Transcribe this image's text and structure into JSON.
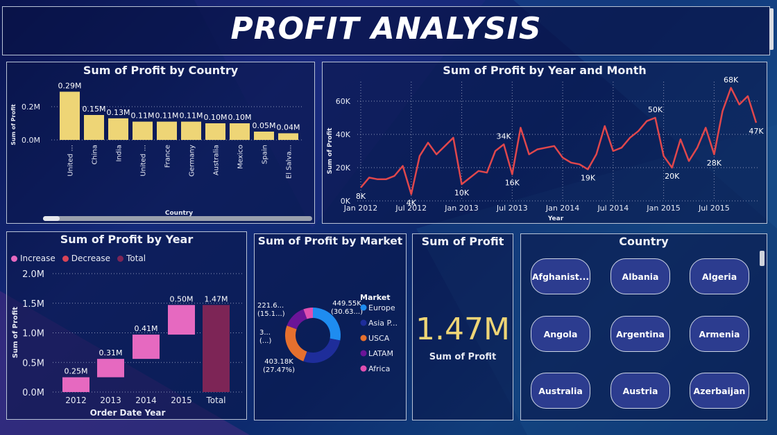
{
  "header": {
    "title": "PROFIT ANALYSIS"
  },
  "colors": {
    "bar_yellow": "#eed576",
    "line_red": "#e0474c",
    "increase": "#e669c0",
    "total": "#7d2556",
    "kpi": "#eed576"
  },
  "chart_data": [
    {
      "id": "country",
      "type": "bar",
      "title": "Sum of Profit by Country",
      "xlabel": "Country",
      "ylabel": "Sum of Profit",
      "categories": [
        "United ...",
        "China",
        "India",
        "United ...",
        "France",
        "Germany",
        "Australia",
        "Mexico",
        "Spain",
        "El Salva..."
      ],
      "values": [
        0.29,
        0.15,
        0.13,
        0.11,
        0.11,
        0.11,
        0.1,
        0.1,
        0.05,
        0.04
      ],
      "data_labels": [
        "0.29M",
        "0.15M",
        "0.13M",
        "0.11M",
        "0.11M",
        "0.11M",
        "0.10M",
        "0.10M",
        "0.05M",
        "0.04M"
      ],
      "yticks": [
        "0.0M",
        "0.2M"
      ],
      "ylim": [
        0,
        0.3
      ],
      "grid": true
    },
    {
      "id": "yearmonth",
      "type": "line",
      "title": "Sum of Profit by Year and Month",
      "xlabel": "Year",
      "ylabel": "Sum of Profit",
      "xticks": [
        "Jan 2012",
        "Jul 2012",
        "Jan 2013",
        "Jul 2013",
        "Jan 2014",
        "Jul 2014",
        "Jan 2015",
        "Jul 2015"
      ],
      "yticks": [
        "0K",
        "20K",
        "40K",
        "60K"
      ],
      "ylim": [
        0,
        60
      ],
      "values": [
        8,
        14,
        13,
        13,
        15,
        21,
        4,
        27,
        35,
        28,
        33,
        38,
        10,
        14,
        18,
        17,
        30,
        34,
        16,
        44,
        28,
        31,
        32,
        33,
        26,
        23,
        22,
        19,
        28,
        45,
        30,
        32,
        38,
        42,
        48,
        50,
        27,
        20,
        37,
        24,
        32,
        44,
        28,
        54,
        68,
        58,
        63,
        47
      ],
      "point_labels": [
        {
          "i": 0,
          "text": "8K"
        },
        {
          "i": 6,
          "text": "4K"
        },
        {
          "i": 12,
          "text": "10K"
        },
        {
          "i": 17,
          "text": "34K"
        },
        {
          "i": 18,
          "text": "16K"
        },
        {
          "i": 27,
          "text": "19K"
        },
        {
          "i": 35,
          "text": "50K"
        },
        {
          "i": 37,
          "text": "20K"
        },
        {
          "i": 42,
          "text": "28K"
        },
        {
          "i": 44,
          "text": "68K"
        },
        {
          "i": 47,
          "text": "47K"
        }
      ],
      "grid": true
    },
    {
      "id": "year",
      "type": "waterfall",
      "title": "Sum of Profit by Year",
      "xlabel": "Order Date Year",
      "ylabel": "Sum of Profit",
      "legend": [
        "Increase",
        "Decrease",
        "Total"
      ],
      "legend_colors": [
        "#e669c0",
        "#d94457",
        "#7d2556"
      ],
      "categories": [
        "2012",
        "2013",
        "2014",
        "2015",
        "Total"
      ],
      "values": [
        0.25,
        0.31,
        0.41,
        0.5,
        1.47
      ],
      "data_labels": [
        "0.25M",
        "0.31M",
        "0.41M",
        "0.50M",
        "1.47M"
      ],
      "yticks": [
        "0.0M",
        "0.5M",
        "1.0M",
        "1.5M",
        "2.0M"
      ],
      "ylim": [
        0,
        2.0
      ],
      "grid": true
    },
    {
      "id": "market",
      "type": "pie",
      "title": "Sum of Profit by Market",
      "legend_title": "Market",
      "series": [
        {
          "name": "Europe",
          "value": 449.55,
          "color": "#1e8cf0"
        },
        {
          "name": "Asia P...",
          "value": 443.0,
          "color": "#1e2d9a"
        },
        {
          "name": "USCA",
          "value": 403.18,
          "color": "#e6702e"
        },
        {
          "name": "LATAM",
          "value": 221.6,
          "color": "#6b1598"
        },
        {
          "name": "Africa",
          "value": 88.9,
          "color": "#e04fb0"
        }
      ],
      "labels": [
        {
          "line1": "449.55K",
          "line2": "(30.63...)"
        },
        {
          "line1": "403.18K",
          "line2": "(27.47%)"
        },
        {
          "line1": "3...",
          "line2": "(...)"
        },
        {
          "line1": "221.6...",
          "line2": "(15.1...)"
        }
      ]
    }
  ],
  "kpi": {
    "title": "Sum of Profit",
    "value": "1.47M",
    "label": "Sum of Profit"
  },
  "slicer": {
    "title": "Country",
    "items": [
      "Afghanist...",
      "Albania",
      "Algeria",
      "Angola",
      "Argentina",
      "Armenia",
      "Australia",
      "Austria",
      "Azerbaijan"
    ]
  }
}
